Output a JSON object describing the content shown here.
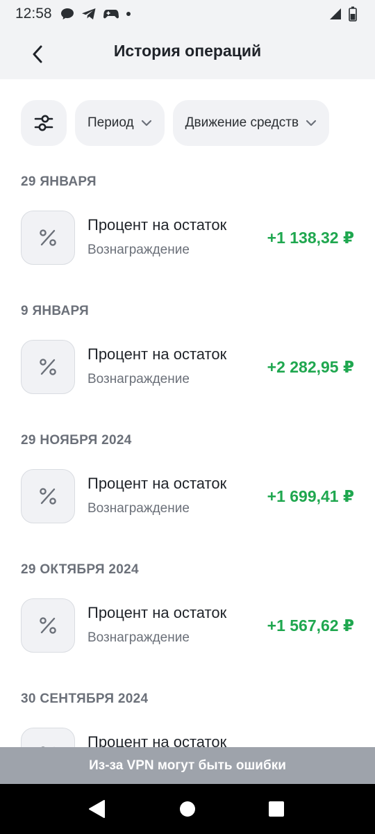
{
  "status_bar": {
    "time": "12:58",
    "left_icons": [
      "chat-bubble-icon",
      "telegram-icon",
      "gamepad-icon",
      "dot-icon"
    ],
    "right_icons": [
      "signal-icon",
      "battery-icon"
    ]
  },
  "header": {
    "title": "История операций",
    "back_icon": "chevron-left-icon"
  },
  "filters": {
    "settings_icon": "filter-sliders-icon",
    "period_label": "Период",
    "movement_label": "Движение средств"
  },
  "operations": [
    {
      "date": "29 ЯНВАРЯ",
      "title": "Процент на остаток",
      "subtitle": "Вознаграждение",
      "amount": "+1 138,32 ₽"
    },
    {
      "date": "9 ЯНВАРЯ",
      "title": "Процент на остаток",
      "subtitle": "Вознаграждение",
      "amount": "+2 282,95 ₽"
    },
    {
      "date": "29 НОЯБРЯ 2024",
      "title": "Процент на остаток",
      "subtitle": "Вознаграждение",
      "amount": "+1 699,41 ₽"
    },
    {
      "date": "29 ОКТЯБРЯ 2024",
      "title": "Процент на остаток",
      "subtitle": "Вознаграждение",
      "amount": "+1 567,62 ₽"
    },
    {
      "date": "30 СЕНТЯБРЯ 2024",
      "title": "Процент на остаток",
      "subtitle": "",
      "amount": ""
    }
  ],
  "banner": {
    "text": "Из-за VPN могут быть ошибки"
  },
  "nav": {
    "back_icon": "triangle-back-icon",
    "home_icon": "circle-home-icon",
    "recents_icon": "square-recents-icon"
  },
  "colors": {
    "accent_green": "#1fa74f",
    "surface": "#f1f2f5",
    "banner": "#9ea3ab"
  }
}
